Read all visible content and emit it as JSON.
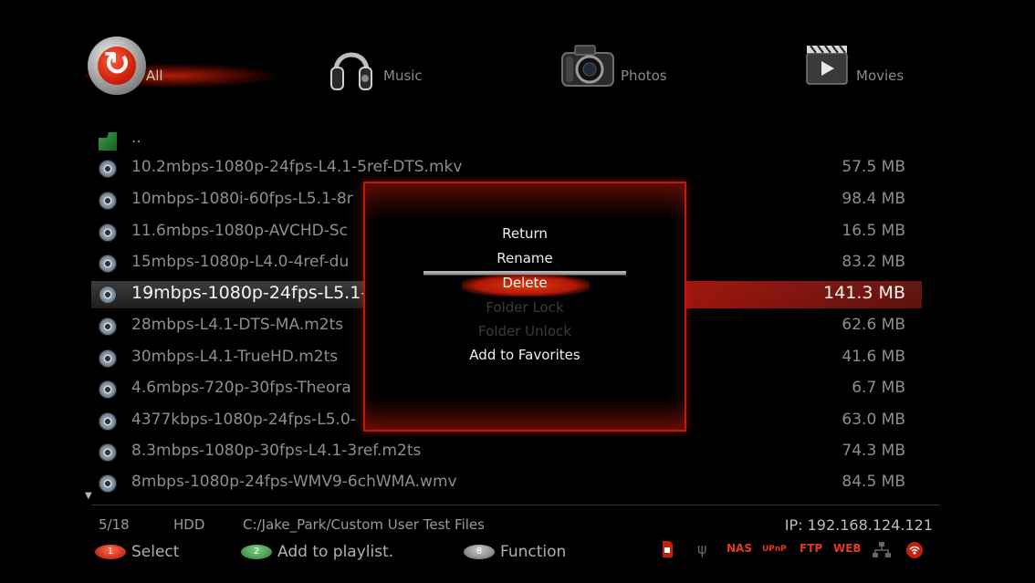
{
  "tabs": [
    {
      "label": "All",
      "icon": "sync-icon",
      "active": true
    },
    {
      "label": "Music",
      "icon": "headphones-icon"
    },
    {
      "label": "Photos",
      "icon": "camera-icon"
    },
    {
      "label": "Movies",
      "icon": "film-play-icon"
    }
  ],
  "list": {
    "parent": "..",
    "files": [
      {
        "name": "10.2mbps-1080p-24fps-L4.1-5ref-DTS.mkv",
        "size": "57.5 MB"
      },
      {
        "name": "10mbps-1080i-60fps-L5.1-8r",
        "size": "98.4 MB"
      },
      {
        "name": "11.6mbps-1080p-AVCHD-Sc",
        "size": "16.5 MB"
      },
      {
        "name": "15mbps-1080p-L4.0-4ref-du",
        "size": "83.2 MB"
      },
      {
        "name": "19mbps-1080p-24fps-L5.1-",
        "size": "141.3 MB",
        "selected": true
      },
      {
        "name": "28mbps-L4.1-DTS-MA.m2ts",
        "size": "62.6 MB"
      },
      {
        "name": "30mbps-L4.1-TrueHD.m2ts",
        "size": "41.6 MB"
      },
      {
        "name": "4.6mbps-720p-30fps-Theora",
        "size": "6.7 MB"
      },
      {
        "name": "4377kbps-1080p-24fps-L5.0-",
        "size": "63.0 MB"
      },
      {
        "name": "8.3mbps-1080p-30fps-L4.1-3ref.m2ts",
        "size": "74.3 MB"
      },
      {
        "name": "8mbps-1080p-24fps-WMV9-6chWMA.wmv",
        "size": "84.5 MB"
      }
    ]
  },
  "menu": {
    "items": [
      {
        "label": "Return",
        "state": "normal"
      },
      {
        "label": "Rename",
        "state": "normal"
      },
      {
        "label": "Delete",
        "state": "active"
      },
      {
        "label": "Folder Lock",
        "state": "disabled"
      },
      {
        "label": "Folder Unlock",
        "state": "disabled"
      },
      {
        "label": "Add to Favorites",
        "state": "normal"
      }
    ]
  },
  "status": {
    "position": "5/18",
    "device": "HDD",
    "path": "C:/Jake_Park/Custom User Test Files",
    "ip": "IP: 192.168.124.121"
  },
  "hints": [
    {
      "key": "1",
      "label": "Select",
      "color": "red"
    },
    {
      "key": "2",
      "label": "Add to playlist.",
      "color": "green"
    },
    {
      "key": "8",
      "label": "Function",
      "color": "grey"
    }
  ],
  "services": [
    "NAS",
    "UPnP",
    "FTP",
    "WEB"
  ],
  "colors": {
    "accent": "#c4180c",
    "text": "#8e8e8e",
    "highlight": "#f4f4f4"
  }
}
